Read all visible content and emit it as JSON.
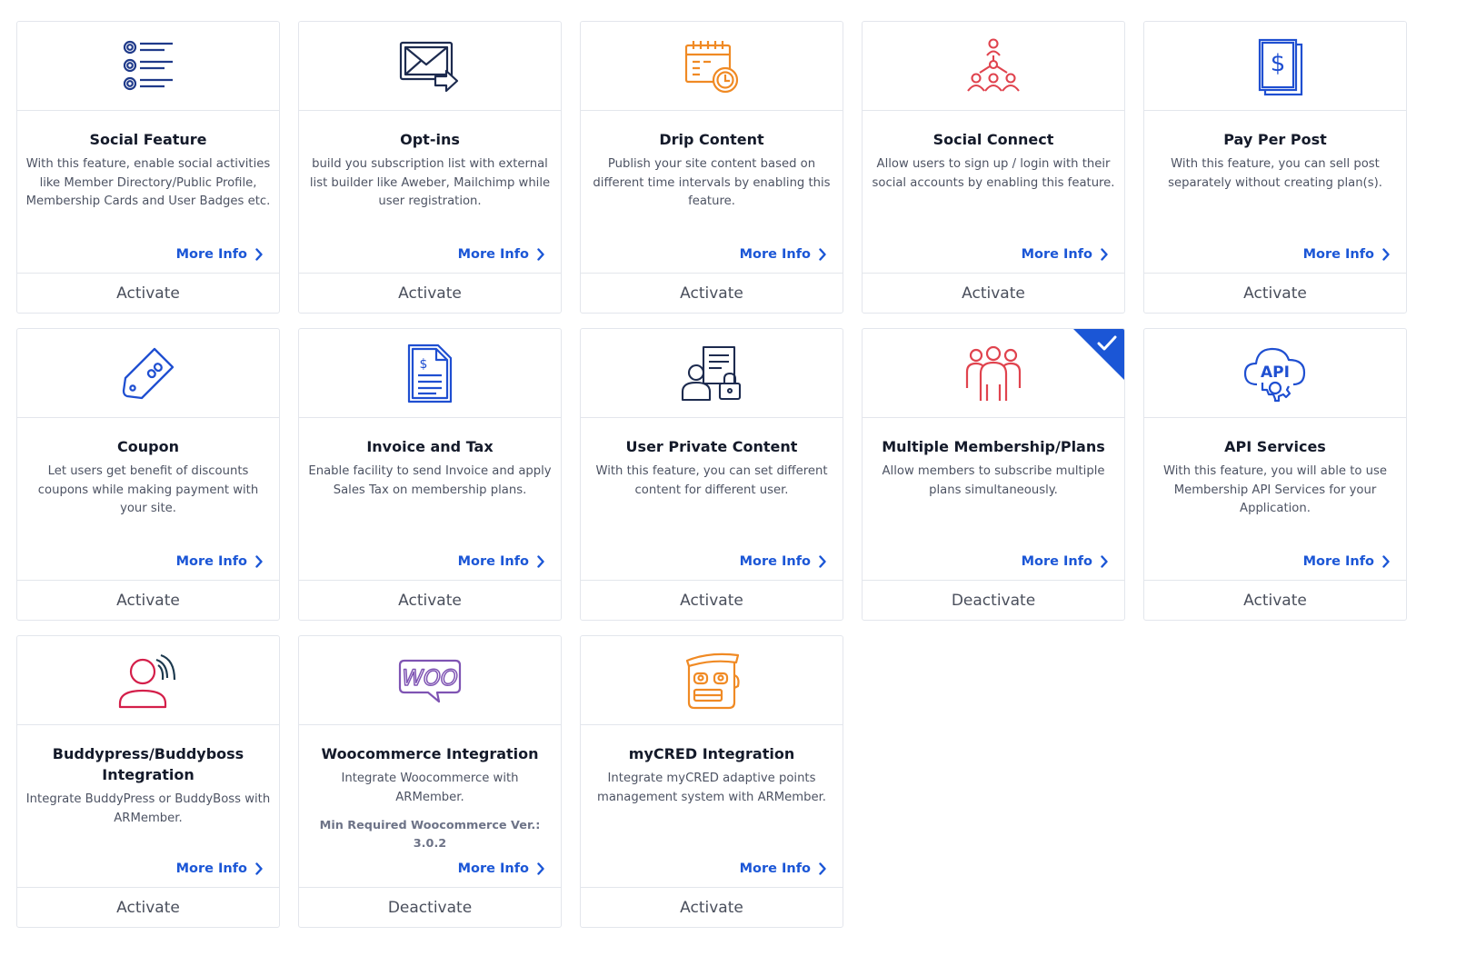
{
  "cards": [
    {
      "title": "Social Feature",
      "desc": "With this feature, enable social activities like Member Directory/Public Profile, Membership Cards and User Badges etc.",
      "more": "More Info",
      "action": "Activate",
      "icon": "list-icon"
    },
    {
      "title": "Opt-ins",
      "desc": "build you subscription list with external list builder like Aweber, Mailchimp while user registration.",
      "more": "More Info",
      "action": "Activate",
      "icon": "mail-arrow-icon"
    },
    {
      "title": "Drip Content",
      "desc": "Publish your site content based on different time intervals by enabling this feature.",
      "more": "More Info",
      "action": "Activate",
      "icon": "calendar-clock-icon"
    },
    {
      "title": "Social Connect",
      "desc": "Allow users to sign up / login with their social accounts by enabling this feature.",
      "more": "More Info",
      "action": "Activate",
      "icon": "network-people-icon"
    },
    {
      "title": "Pay Per Post",
      "desc": "With this feature, you can sell post separately without creating plan(s).",
      "more": "More Info",
      "action": "Activate",
      "icon": "dollar-document-icon"
    },
    {
      "title": "Coupon",
      "desc": "Let users get benefit of discounts coupons while making payment with your site.",
      "more": "More Info",
      "action": "Activate",
      "icon": "coupon-tag-icon"
    },
    {
      "title": "Invoice and Tax",
      "desc": "Enable facility to send Invoice and apply Sales Tax on membership plans.",
      "more": "More Info",
      "action": "Activate",
      "icon": "invoice-icon"
    },
    {
      "title": "User Private Content",
      "desc": "With this feature, you can set different content for different user.",
      "more": "More Info",
      "action": "Activate",
      "icon": "user-lock-icon"
    },
    {
      "title": "Multiple Membership/Plans",
      "desc": "Allow members to subscribe multiple plans simultaneously.",
      "more": "More Info",
      "action": "Deactivate",
      "icon": "group-people-icon",
      "active": true
    },
    {
      "title": "API Services",
      "desc": "With this feature, you will able to use Membership API Services for your Application.",
      "more": "More Info",
      "action": "Activate",
      "icon": "api-cloud-gear-icon"
    },
    {
      "title": "Buddypress/Buddyboss Integration",
      "desc": "Integrate BuddyPress or BuddyBoss with ARMember.",
      "more": "More Info",
      "action": "Activate",
      "icon": "buddypress-user-icon"
    },
    {
      "title": "Woocommerce Integration",
      "desc": "Integrate Woocommerce with ARMember.",
      "req": "Min Required Woocommerce Ver.: 3.0.2",
      "more": "More Info",
      "action": "Deactivate",
      "icon": "woo-logo-icon",
      "logo_text": "WOO"
    },
    {
      "title": "myCRED Integration",
      "desc": "Integrate myCRED adaptive points management system with ARMember.",
      "more": "More Info",
      "action": "Activate",
      "icon": "mycred-face-icon"
    }
  ],
  "colors": {
    "link_blue": "#1b56d6",
    "icon_navy": "#1f3a8a",
    "icon_orange": "#f08a24",
    "icon_red": "#e0434e",
    "icon_blue": "#1f4fd1",
    "icon_crimson": "#d41f4a",
    "woo_purple": "#7f54b3",
    "badge_blue": "#1b56d6"
  }
}
